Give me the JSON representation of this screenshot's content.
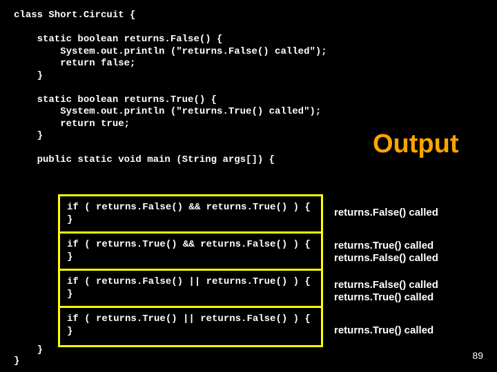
{
  "code": {
    "class_decl": "class Short.Circuit {",
    "method_false": "    static boolean returns.False() {\n        System.out.println (\"returns.False() called\");\n        return false;\n    }",
    "method_true": "    static boolean returns.True() {\n        System.out.println (\"returns.True() called\");\n        return true;\n    }",
    "main_decl": "    public static void main (String args[]) {",
    "ifs": [
      "if ( returns.False() && returns.True() ) {\n}",
      "if ( returns.True() && returns.False() ) {\n}",
      "if ( returns.False() || returns.True() ) {\n}",
      "if ( returns.True() || returns.False() ) {\n}"
    ],
    "close_main": "    }",
    "close_class": "}"
  },
  "output": {
    "heading": "Output",
    "rows": [
      [
        "returns.False() called"
      ],
      [
        "returns.True() called",
        "returns.False() called"
      ],
      [
        "returns.False() called",
        "returns.True() called"
      ],
      [
        "returns.True() called"
      ]
    ]
  },
  "slide_number": "89"
}
